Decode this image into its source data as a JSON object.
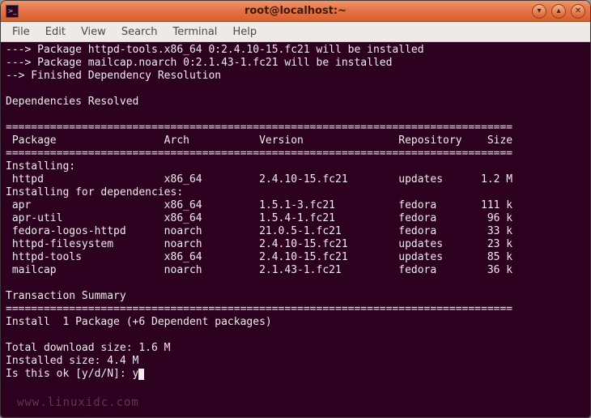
{
  "window": {
    "title": "root@localhost:~",
    "icon_glyph": ">_",
    "buttons": {
      "min": "▾",
      "max": "▴",
      "close": "✕"
    }
  },
  "menubar": [
    "File",
    "Edit",
    "View",
    "Search",
    "Terminal",
    "Help"
  ],
  "term": {
    "pre_lines": [
      "---> Package httpd-tools.x86_64 0:2.4.10-15.fc21 will be installed",
      "---> Package mailcap.noarch 0:2.1.43-1.fc21 will be installed",
      "--> Finished Dependency Resolution",
      "",
      "Dependencies Resolved",
      ""
    ],
    "sep": "================================================================================",
    "header": {
      "c0": " Package",
      "c1": "Arch",
      "c2": "Version",
      "c3": "Repository",
      "c4": "Size"
    },
    "install_label": "Installing:",
    "install_rows": [
      {
        "c0": " httpd",
        "c1": "x86_64",
        "c2": "2.4.10-15.fc21",
        "c3": "updates",
        "c4": "1.2 M"
      }
    ],
    "dep_label": "Installing for dependencies:",
    "dep_rows": [
      {
        "c0": " apr",
        "c1": "x86_64",
        "c2": "1.5.1-3.fc21",
        "c3": "fedora",
        "c4": "111 k"
      },
      {
        "c0": " apr-util",
        "c1": "x86_64",
        "c2": "1.5.4-1.fc21",
        "c3": "fedora",
        "c4": "96 k"
      },
      {
        "c0": " fedora-logos-httpd",
        "c1": "noarch",
        "c2": "21.0.5-1.fc21",
        "c3": "fedora",
        "c4": "33 k"
      },
      {
        "c0": " httpd-filesystem",
        "c1": "noarch",
        "c2": "2.4.10-15.fc21",
        "c3": "updates",
        "c4": "23 k"
      },
      {
        "c0": " httpd-tools",
        "c1": "x86_64",
        "c2": "2.4.10-15.fc21",
        "c3": "updates",
        "c4": "85 k"
      },
      {
        "c0": " mailcap",
        "c1": "noarch",
        "c2": "2.1.43-1.fc21",
        "c3": "fedora",
        "c4": "36 k"
      }
    ],
    "tx_summary": "Transaction Summary",
    "install_summary": "Install  1 Package (+6 Dependent packages)",
    "dl_size": "Total download size: 1.6 M",
    "inst_size": "Installed size: 4.4 M",
    "prompt": "Is this ok [y/d/N]: y"
  },
  "watermark": "www.linuxidc.com"
}
